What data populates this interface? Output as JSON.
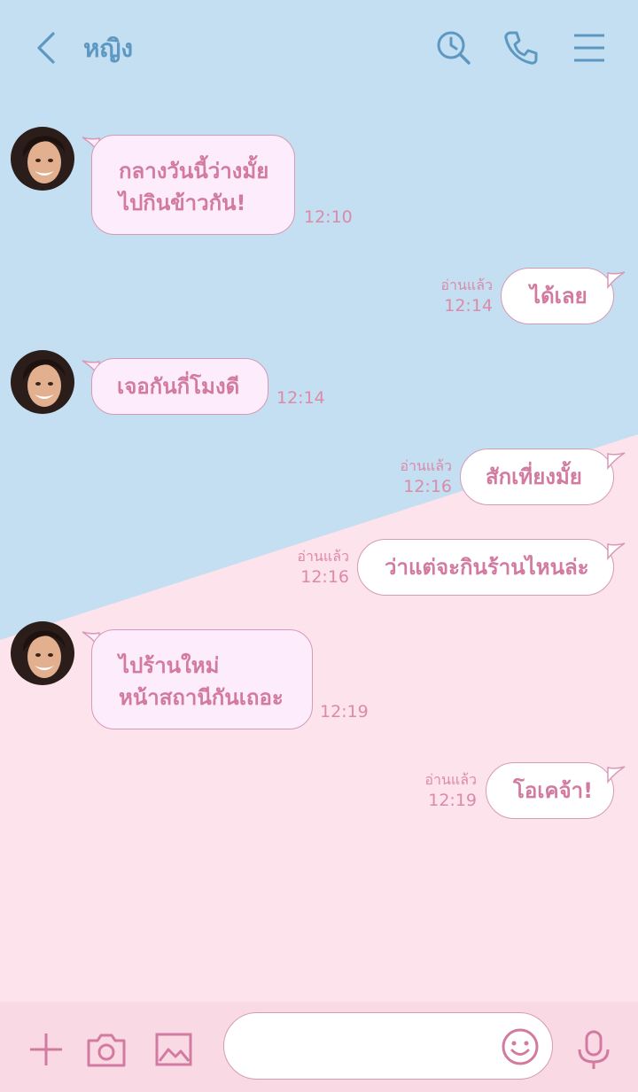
{
  "header": {
    "title": "หญิง"
  },
  "messages": [
    {
      "side": "in",
      "lines": [
        "กลางวันนี้ว่างมั้ย",
        "ไปกินข้าวกัน!"
      ],
      "time": "12:10"
    },
    {
      "side": "out",
      "lines": [
        "ได้เลย"
      ],
      "time": "12:14",
      "read": "อ่านแล้ว"
    },
    {
      "side": "in",
      "lines": [
        "เจอกันกี่โมงดี"
      ],
      "time": "12:14"
    },
    {
      "side": "out",
      "lines": [
        "สักเที่ยงมั้ย"
      ],
      "time": "12:16",
      "read": "อ่านแล้ว"
    },
    {
      "side": "out",
      "lines": [
        "ว่าแต่จะกินร้านไหนล่ะ"
      ],
      "time": "12:16",
      "read": "อ่านแล้ว"
    },
    {
      "side": "in",
      "lines": [
        "ไปร้านใหม่",
        "หน้าสถานีกันเถอะ"
      ],
      "time": "12:19"
    },
    {
      "side": "out",
      "lines": [
        "โอเคจ้า!"
      ],
      "time": "12:19",
      "read": "อ่านแล้ว"
    }
  ],
  "colors": {
    "top_background": "#c3dff1",
    "bottom_background": "#fde3ec",
    "header_icon": "#5d98c2",
    "accent_pink": "#d27aa0"
  },
  "icons": [
    "back-arrow-icon",
    "search-history-icon",
    "phone-icon",
    "menu-icon",
    "plus-icon",
    "camera-icon",
    "image-icon",
    "emoji-icon",
    "microphone-icon"
  ]
}
